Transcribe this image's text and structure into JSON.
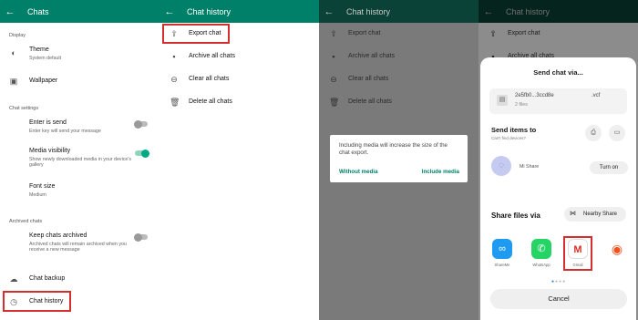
{
  "panel1": {
    "title": "Chats",
    "display_header": "Display",
    "theme": {
      "label": "Theme",
      "sub": "System default"
    },
    "wallpaper": {
      "label": "Wallpaper"
    },
    "chat_settings_header": "Chat settings",
    "enter_is_send": {
      "label": "Enter is send",
      "sub": "Enter key will send your message",
      "on": false
    },
    "media_visibility": {
      "label": "Media visibility",
      "sub": "Show newly downloaded media in your device's gallery",
      "on": true
    },
    "font_size": {
      "label": "Font size",
      "sub": "Medium"
    },
    "archived_header": "Archived chats",
    "keep_archived": {
      "label": "Keep chats archived",
      "sub": "Archived chats will remain archived when you receive a new message",
      "on": false
    },
    "chat_backup": "Chat backup",
    "chat_history": "Chat history"
  },
  "history": {
    "title": "Chat history",
    "items": [
      "Export chat",
      "Archive all chats",
      "Clear all chats",
      "Delete all chats"
    ]
  },
  "dialog": {
    "message": "Including media will increase the size of the chat export.",
    "without_media": "Without media",
    "include_media": "Include media"
  },
  "share": {
    "title": "Send chat via...",
    "file_name": "2e5fb0...3ccd8e",
    "file_ext": ".vcf",
    "file_count": "2 files",
    "send_items": "Send items to",
    "cant_find": "Can't find devices?",
    "mi_share": "Mi Share",
    "turn_on": "Turn on",
    "share_files_via": "Share files via",
    "nearby_share": "Nearby Share",
    "apps": [
      "ShareMe",
      "WhatsApp",
      "Gmail",
      ""
    ],
    "cancel": "Cancel"
  },
  "colors": {
    "whatsapp_green": "#008069",
    "highlight_red": "#d32f2f",
    "dark_appbar": "#0b4237"
  },
  "icons": [
    "back-arrow-icon",
    "theme-icon",
    "wallpaper-icon",
    "cloud-backup-icon",
    "history-icon",
    "export-icon",
    "archive-icon",
    "clear-icon",
    "trash-icon",
    "file-icon",
    "printer-icon",
    "monitor-icon",
    "mi-share-icon",
    "nearby-share-icon",
    "shareme-icon",
    "whatsapp-icon",
    "gmail-icon",
    "other-app-icon"
  ]
}
